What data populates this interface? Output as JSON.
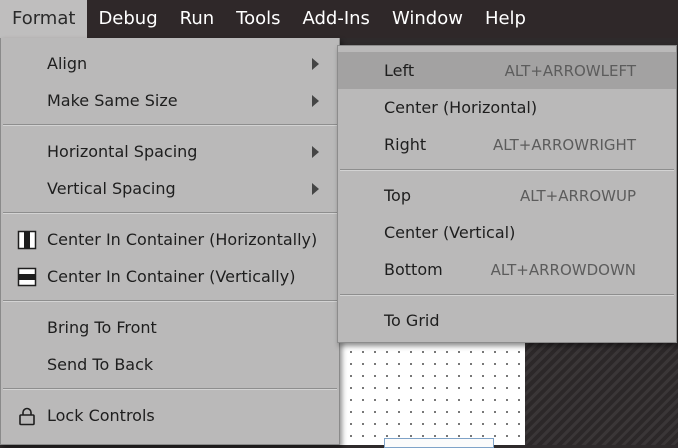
{
  "menubar": {
    "items": [
      {
        "label": "Format",
        "active": true
      },
      {
        "label": "Debug"
      },
      {
        "label": "Run"
      },
      {
        "label": "Tools"
      },
      {
        "label": "Add-Ins"
      },
      {
        "label": "Window"
      },
      {
        "label": "Help"
      }
    ]
  },
  "format_menu": {
    "items": [
      {
        "label": "Align",
        "submenu": true,
        "icon": null
      },
      {
        "label": "Make Same Size",
        "submenu": true,
        "icon": null
      },
      {
        "label": "Horizontal Spacing",
        "submenu": true,
        "icon": null
      },
      {
        "label": "Vertical Spacing",
        "submenu": true,
        "icon": null
      },
      {
        "label": "Center In Container (Horizontally)",
        "icon": "center-horizontal-icon"
      },
      {
        "label": "Center In Container (Vertically)",
        "icon": "center-vertical-icon"
      },
      {
        "label": "Bring To Front",
        "icon": null
      },
      {
        "label": "Send To Back",
        "icon": null
      },
      {
        "label": "Lock Controls",
        "icon": "lock-icon"
      }
    ]
  },
  "align_submenu": {
    "items": [
      {
        "label": "Left",
        "shortcut": "ALT+ARROWLEFT",
        "highlighted": true
      },
      {
        "label": "Center (Horizontal)",
        "shortcut": ""
      },
      {
        "label": "Right",
        "shortcut": "ALT+ARROWRIGHT"
      },
      {
        "label": "Top",
        "shortcut": "ALT+ARROWUP"
      },
      {
        "label": "Center (Vertical)",
        "shortcut": ""
      },
      {
        "label": "Bottom",
        "shortcut": "ALT+ARROWDOWN"
      },
      {
        "label": "To Grid",
        "shortcut": ""
      }
    ]
  },
  "colors": {
    "menubar_bg": "#2f2829",
    "menu_bg": "#bab9b9",
    "highlight_bg": "#a3a2a2"
  }
}
